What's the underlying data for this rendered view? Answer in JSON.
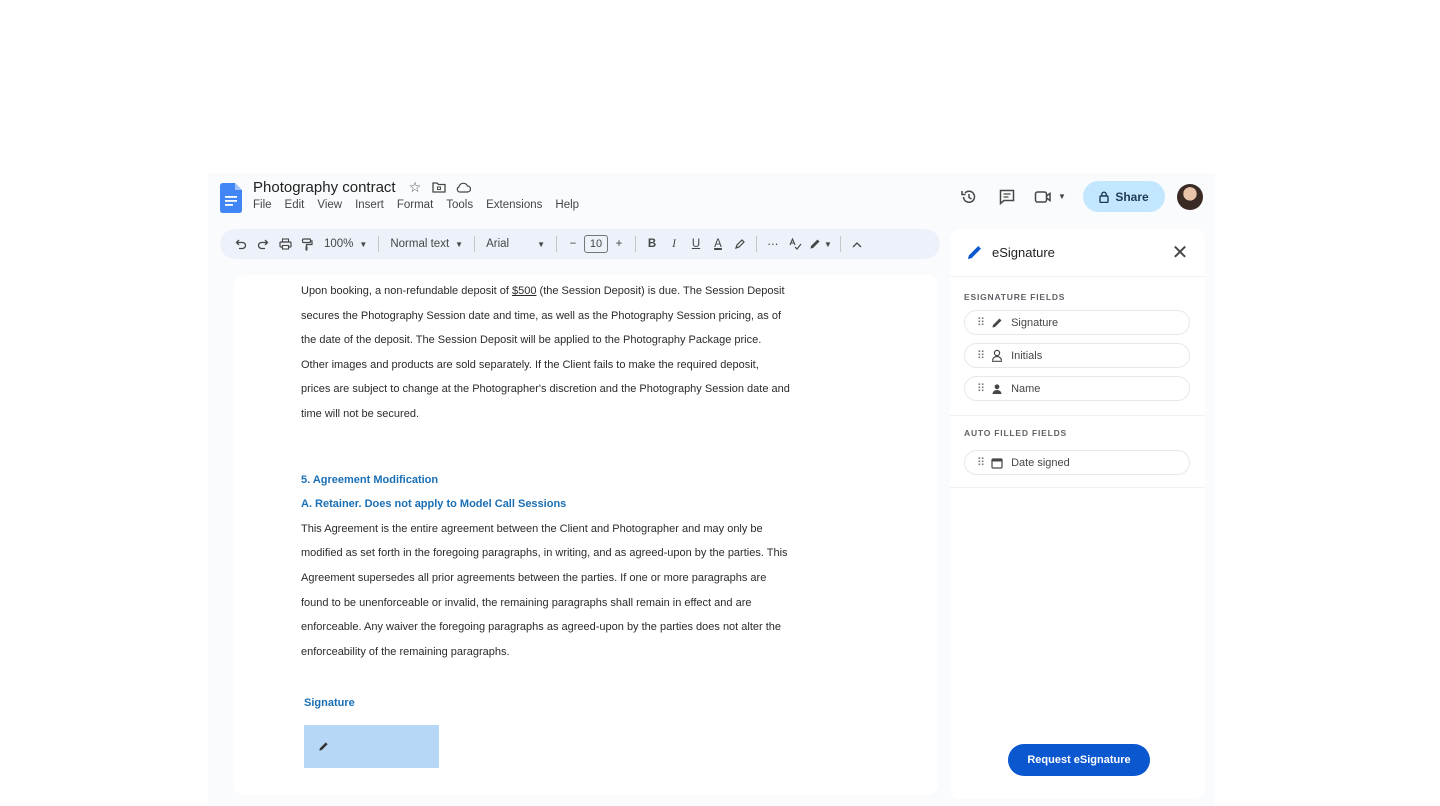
{
  "header": {
    "title": "Photography contract",
    "menu": [
      "File",
      "Edit",
      "View",
      "Insert",
      "Format",
      "Tools",
      "Extensions",
      "Help"
    ],
    "share_label": "Share"
  },
  "toolbar": {
    "zoom": "100%",
    "style": "Normal text",
    "font": "Arial",
    "font_size": "10"
  },
  "document": {
    "para1_before": "Upon booking, a non-refundable deposit of ",
    "para1_amount": "$500",
    "para1_after": " (the Session Deposit) is due. The Session Deposit secures the Photography Session date and time, as well as the Photography Session pricing, as of the date of the deposit. The Session Deposit will be applied to the Photography Package price. Other images and products are sold separately. If the Client fails to make the required deposit, prices are subject to change at the Photographer's discretion and the Photography Session date and time will not be secured.",
    "heading": "5. Agreement Modification",
    "subheading": "A. Retainer.  Does not apply to Model Call Sessions",
    "para2": "This Agreement is the entire agreement between the Client and Photographer and may only be modified as set forth in the foregoing paragraphs, in writing, and as agreed-upon by the parties.  This Agreement supersedes all prior agreements between the parties. If one or more paragraphs are found to be unenforceable or invalid, the remaining paragraphs shall remain in effect and are enforceable. Any waiver the foregoing paragraphs as agreed-upon by the parties does not alter the enforceability of the remaining paragraphs.",
    "signature_heading": "Signature"
  },
  "panel": {
    "title": "eSignature",
    "section1": "ESIGNATURE FIELDS",
    "fields": [
      "Signature",
      "Initials",
      "Name"
    ],
    "section2": "AUTO FILLED FIELDS",
    "auto_fields": [
      "Date signed"
    ],
    "request_label": "Request eSignature"
  },
  "colors": {
    "accent": "#0b57d0",
    "share_bg": "#c2e7ff",
    "heading_blue": "#1a6fb5",
    "signature_box": "#b7d7f6"
  }
}
